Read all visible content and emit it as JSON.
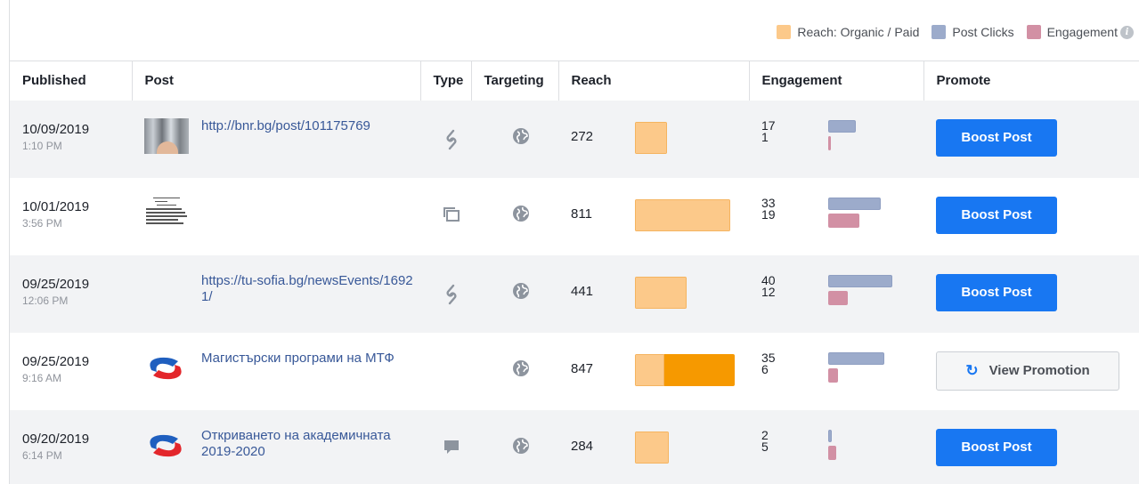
{
  "legend": {
    "items": [
      {
        "label": "Reach: Organic / Paid",
        "color": "#fcc98a"
      },
      {
        "label": "Post Clicks",
        "color": "#9cabcb"
      },
      {
        "label": "Engagement",
        "color": "#d290a4"
      }
    ],
    "info_icon": "info-icon"
  },
  "table": {
    "headers": [
      "Published",
      "Post",
      "Type",
      "Targeting",
      "Reach",
      "Engagement",
      "Promote"
    ],
    "rows": [
      {
        "date": "10/09/2019",
        "time": "1:10 PM",
        "thumb": "photo",
        "post": "http://bnr.bg/post/101175769",
        "post_is_link": true,
        "type_icon": "link-icon",
        "targeting_icon": "globe-icon",
        "reach": "272",
        "reach_organic": 272,
        "reach_paid": 0,
        "clicks": "17",
        "engagement": "1",
        "promote": "Boost Post"
      },
      {
        "date": "10/01/2019",
        "time": "3:56 PM",
        "thumb": "document",
        "post": "",
        "post_is_link": false,
        "type_icon": "album-icon",
        "targeting_icon": "globe-icon",
        "reach": "811",
        "reach_organic": 811,
        "reach_paid": 0,
        "clicks": "33",
        "engagement": "19",
        "promote": "Boost Post"
      },
      {
        "date": "09/25/2019",
        "time": "12:06 PM",
        "thumb": "blank",
        "post": "https://tu-sofia.bg/newsEvents/16921/",
        "post_is_link": true,
        "type_icon": "link-icon",
        "targeting_icon": "globe-icon",
        "reach": "441",
        "reach_organic": 441,
        "reach_paid": 0,
        "clicks": "40",
        "engagement": "12",
        "promote": "Boost Post"
      },
      {
        "date": "09/25/2019",
        "time": "9:16 AM",
        "thumb": "logo",
        "post": "Магистърски програми на МТФ",
        "post_is_link": false,
        "type_icon": "",
        "targeting_icon": "globe-icon",
        "reach": "847",
        "reach_organic": 251,
        "reach_paid": 596,
        "clicks": "35",
        "engagement": "6",
        "promote": "View Promotion"
      },
      {
        "date": "09/20/2019",
        "time": "6:14 PM",
        "thumb": "logo",
        "post": "Откриването на академичната 2019-2020",
        "post_is_link": false,
        "type_icon": "status-icon",
        "targeting_icon": "globe-icon",
        "reach": "284",
        "reach_organic": 284,
        "reach_paid": 0,
        "clicks": "2",
        "engagement": "5",
        "promote": "Boost Post"
      }
    ]
  }
}
